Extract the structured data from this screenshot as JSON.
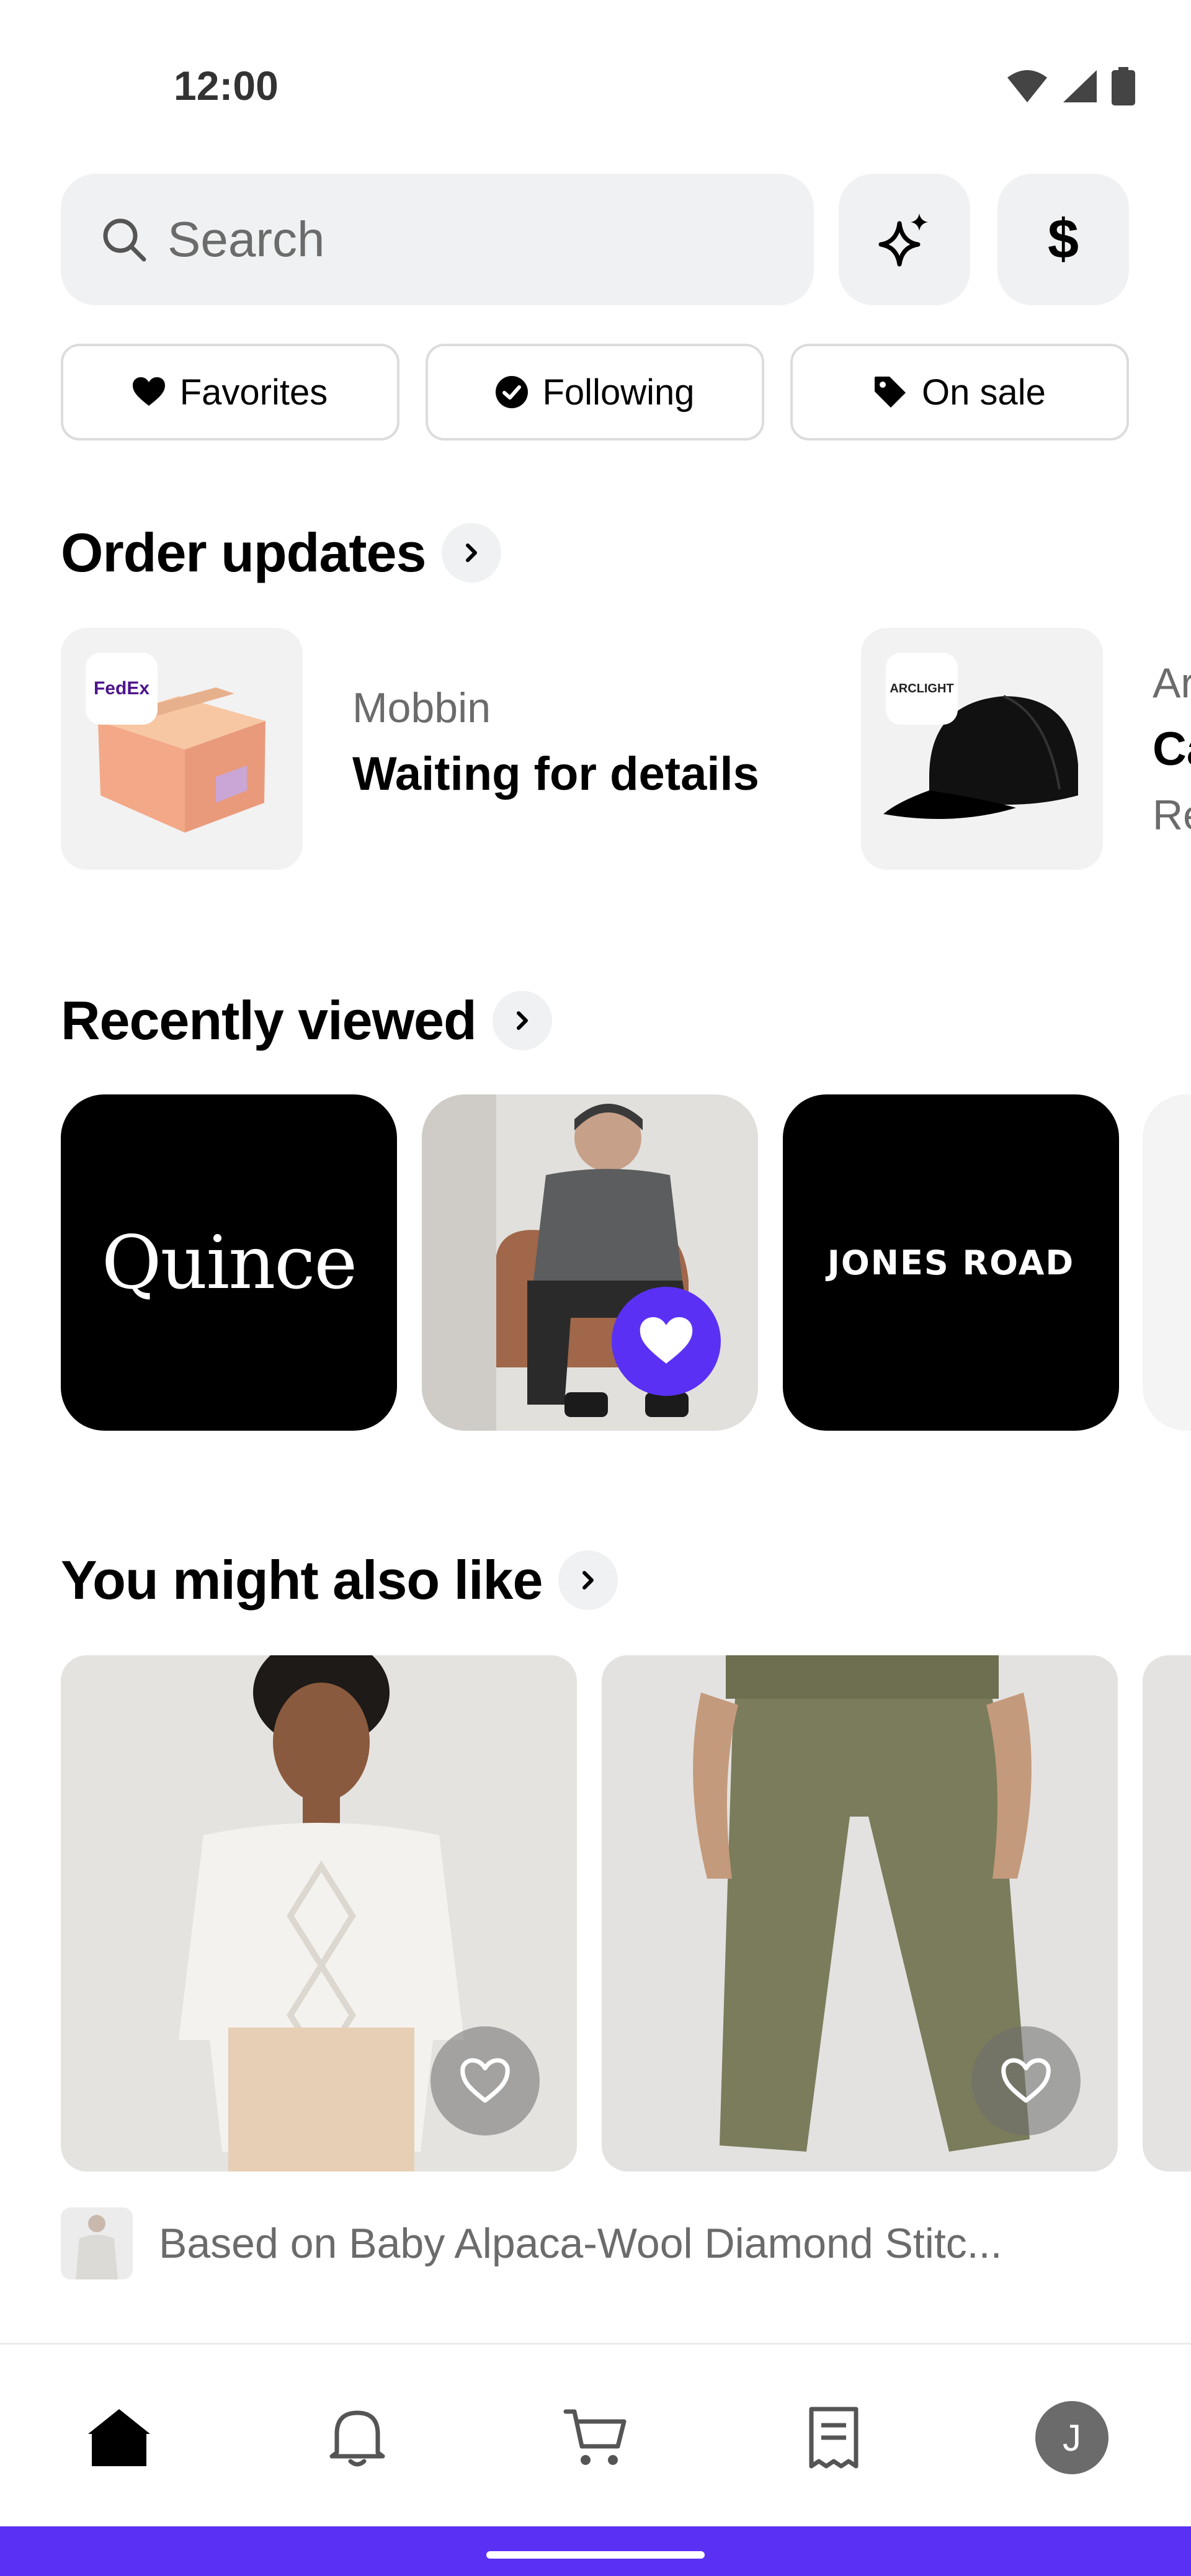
{
  "status_bar": {
    "time": "12:00",
    "icons": [
      "wifi-icon",
      "signal-icon",
      "battery-icon"
    ]
  },
  "search": {
    "placeholder": "Search"
  },
  "chips": [
    {
      "label": "Favorites",
      "icon": "heart-icon"
    },
    {
      "label": "Following",
      "icon": "check-circle-icon"
    },
    {
      "label": "On sale",
      "icon": "tag-icon"
    }
  ],
  "sections": {
    "order_updates": "Order updates",
    "recently_viewed": "Recently viewed",
    "might_also_like": "You might also like"
  },
  "orders": [
    {
      "carrier": "FedEx",
      "store": "Mobbin",
      "status": "Waiting for details"
    },
    {
      "carrier": "ARCLIGHT",
      "store": "Ar",
      "status": "Ca",
      "sub": "Re"
    }
  ],
  "recently_viewed": [
    {
      "type": "brand",
      "text": "Quince"
    },
    {
      "type": "product",
      "favorited": true
    },
    {
      "type": "brand",
      "text": "JONES ROAD"
    }
  ],
  "recommendations": {
    "based_on": "Based on Baby Alpaca-Wool Diamond Stitc..."
  },
  "bottom_nav": {
    "items": [
      "home-icon",
      "bell-icon",
      "cart-icon",
      "receipt-icon",
      "avatar"
    ],
    "avatar_initial": "J"
  },
  "colors": {
    "accent": "#5a31f4",
    "chip_border": "#dcdcdc",
    "surface": "#f0f1f2",
    "muted_text": "#6b6b6b"
  }
}
